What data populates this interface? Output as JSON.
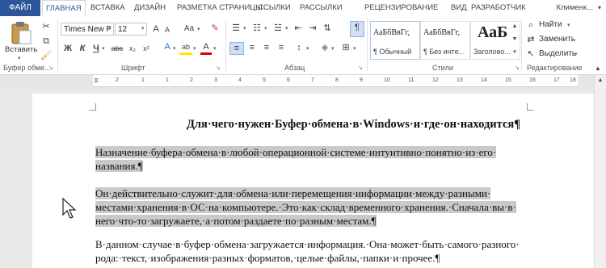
{
  "tabs": {
    "file": "ФАЙЛ",
    "items": [
      "ГЛАВНАЯ",
      "ВСТАВКА",
      "ДИЗАЙН",
      "РАЗМЕТКА СТРАНИЦЫ",
      "ССЫЛКИ",
      "РАССЫЛКИ",
      "РЕЦЕНЗИРОВАНИЕ",
      "ВИД",
      "РАЗРАБОТЧИК"
    ],
    "user": "Клименк..."
  },
  "clipboard": {
    "paste": "Вставить",
    "group": "Буфер обме..."
  },
  "font": {
    "name": "Times New F",
    "size": "12",
    "group": "Шрифт",
    "bold": "Ж",
    "italic": "К",
    "underline": "Ч",
    "strike": "abc",
    "sub": "x₂",
    "sup": "x²",
    "grow": "A",
    "shrink": "A",
    "case": "Aa",
    "color_a": "A",
    "highlight": "ab",
    "font_a": "A"
  },
  "paragraph": {
    "group": "Абзац",
    "pilcrow": "¶"
  },
  "styles": {
    "group": "Стили",
    "items": [
      {
        "preview": "АаБбВвГг,",
        "name": "¶ Обычный"
      },
      {
        "preview": "АаБбВвГг,",
        "name": "¶ Без инте..."
      },
      {
        "preview": "АаБ",
        "name": "Заголово..."
      }
    ]
  },
  "editing": {
    "find": "Найти",
    "replace": "Заменить",
    "select": "Выделить",
    "group": "Редактирование"
  },
  "ruler": {
    "numbers": [
      "2",
      "1",
      "1",
      "2",
      "3",
      "4",
      "5",
      "6",
      "7",
      "8",
      "9",
      "10",
      "11",
      "12",
      "13",
      "14",
      "15",
      "16",
      "17",
      "18"
    ]
  },
  "document": {
    "title": "Для·чего·нужен·Буфер·обмена·в·Windows·и·где·он·находится¶",
    "p1": [
      "Назначение·буфера·обмена·в·любой·операционной·системе·интуитивно·понятно·из·его·",
      "названия.¶"
    ],
    "p2": [
      "Он·действительно·служит·для·обмена·или·перемещения·информации·между·разными·",
      "местами·хранения·в·ОС·на·компьютере.·Это·как·склад·временного·хранения.·Сначала·вы·в·",
      "него·что-то·загружаете,·а·потом·раздаете·по·разным·местам.¶"
    ],
    "p3": [
      "В·данном·случае·в·буфер·обмена·загружается·информация.·Она·может·быть·самого·разного·",
      "рода:·текст,·изображения·разных·форматов,·целые·файлы,·папки·и·прочее.¶"
    ]
  }
}
